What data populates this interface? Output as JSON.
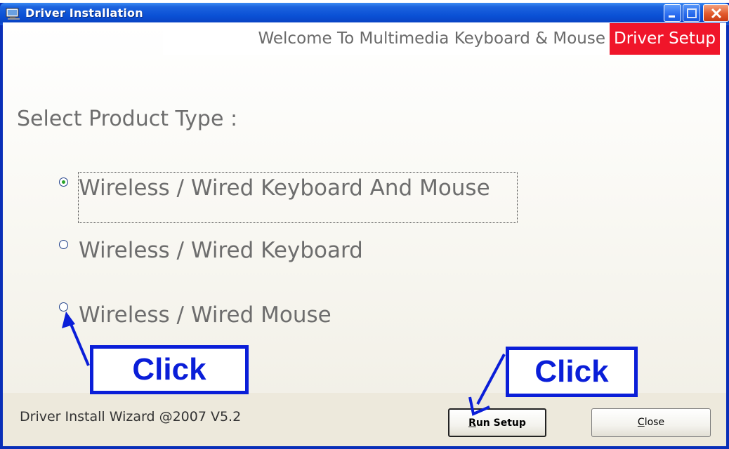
{
  "window": {
    "title": "Driver Installation",
    "icons": {
      "app": "computer-icon",
      "minimize": "minimize-icon",
      "maximize": "maximize-icon",
      "close": "close-icon"
    }
  },
  "banner": {
    "welcome": "Welcome To Multimedia Keyboard & Mouse",
    "badge": "Driver Setup"
  },
  "heading": "Select Product Type :",
  "options": [
    {
      "label": "Wireless / Wired Keyboard And Mouse",
      "selected": true
    },
    {
      "label": "Wireless / Wired Keyboard",
      "selected": false
    },
    {
      "label": "Wireless / Wired Mouse",
      "selected": false
    }
  ],
  "footer": {
    "version": "Driver Install Wizard @2007 V5.2",
    "run_setup": {
      "mnemonic": "R",
      "rest": "un Setup"
    },
    "close": {
      "mnemonic": "C",
      "rest": "lose"
    }
  },
  "annotations": {
    "click_1": "Click",
    "click_2": "Click",
    "color": "#0a1ed8"
  },
  "colors": {
    "title_bar": "#0b52d6",
    "badge_bg": "#f0152a",
    "radio_dot": "#29a329"
  }
}
